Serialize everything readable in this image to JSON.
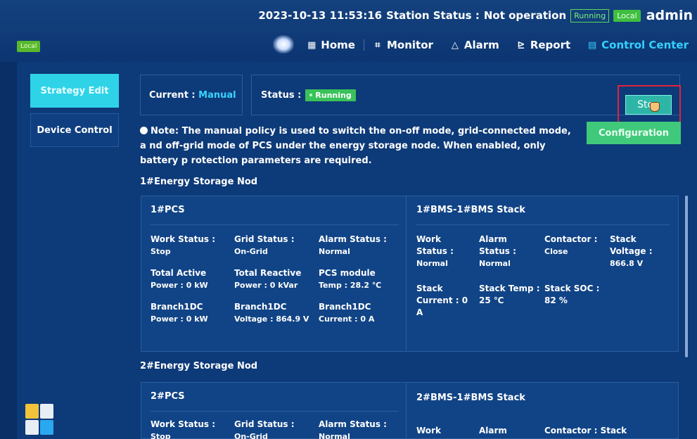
{
  "topbar": {
    "datetime": "2023-10-13 11:53:16",
    "station_status_label": "Station Status :",
    "station_status_value": "Not operation",
    "running_badge": "Running",
    "local_badge": "Local",
    "user": "admin",
    "local_left": "Local"
  },
  "nav": {
    "items": [
      {
        "label": "Home",
        "icon": "grid-icon"
      },
      {
        "label": "Monitor",
        "icon": "monitor-icon"
      },
      {
        "label": "Alarm",
        "icon": "alarm-icon"
      },
      {
        "label": "Report",
        "icon": "report-icon"
      },
      {
        "label": "Control Center",
        "icon": "control-icon"
      }
    ]
  },
  "sidebar": {
    "items": [
      {
        "label": "Strategy Edit"
      },
      {
        "label": "Device Control"
      }
    ]
  },
  "control": {
    "current_label": "Current :",
    "current_value": "Manual",
    "status_label": "Status :",
    "status_value": "Running",
    "stop_label": "Stop",
    "configuration_label": "Configuration",
    "note": "Note: The manual policy is used to switch the on-off mode, grid-connected mode, a nd off-grid mode of PCS under the energy storage node. When enabled, only battery p rotection parameters are required."
  },
  "nodes": [
    {
      "title": "1#Energy Storage Nod",
      "pcs": {
        "title": "1#PCS",
        "work_status_label": "Work Status :",
        "work_status": "Stop",
        "grid_status_label": "Grid Status :",
        "grid_status": "On-Grid",
        "alarm_status_label": "Alarm Status :",
        "alarm_status": "Normal",
        "total_active_label": "Total Active",
        "total_active": "Power : 0 kW",
        "total_reactive_label": "Total Reactive",
        "total_reactive": "Power : 0 kVar",
        "module_label": "PCS module",
        "module_temp": "Temp : 28.2 ℃",
        "b_power_label": "Branch1DC",
        "b_power": "Power : 0 kW",
        "b_voltage_label": "Branch1DC",
        "b_voltage": "Voltage : 864.9 V",
        "b_current_label": "Branch1DC",
        "b_current": "Current : 0 A"
      },
      "bms": {
        "title": "1#BMS-1#BMS Stack",
        "work_label": "Work Status :",
        "work": "Normal",
        "alarm_label": "Alarm Status :",
        "alarm": "Normal",
        "contactor_label": "Contactor :",
        "contactor": "Close",
        "voltage_label": "Stack Voltage :",
        "voltage": "866.8 V",
        "current_label": "Stack Current : 0 A",
        "temp_label": "Stack Temp : 25 ℃",
        "soc_label": "Stack SOC : 82 %"
      }
    },
    {
      "title": "2#Energy Storage Nod",
      "pcs": {
        "title": "2#PCS",
        "work_status_label": "Work Status :",
        "work_status": "Stop",
        "grid_status_label": "Grid Status :",
        "grid_status": "On-Grid",
        "alarm_status_label": "Alarm Status :",
        "alarm_status": "Normal"
      },
      "bms": {
        "title": "2#BMS-1#BMS Stack",
        "work_label": "Work",
        "alarm_label": "Alarm",
        "contactor_label": "Contactor : Stack"
      }
    }
  ],
  "colors": {
    "background": "#0a2f66",
    "accent": "#35d0ff",
    "running": "#39c25a",
    "stop_highlight": "#e0233a",
    "configuration": "#40c97a"
  }
}
